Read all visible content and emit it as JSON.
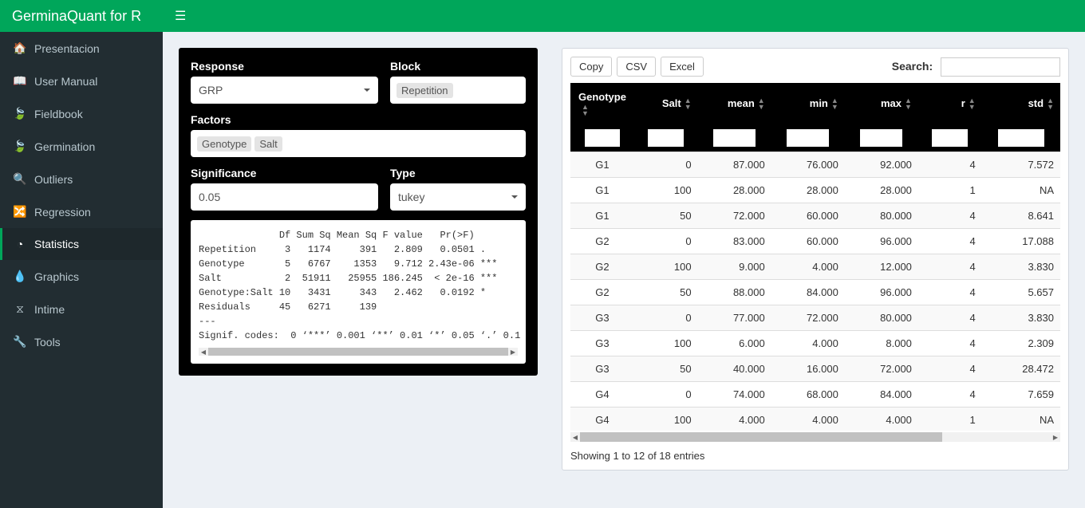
{
  "header": {
    "title": "GerminaQuant for R"
  },
  "sidebar": {
    "items": [
      {
        "icon": "🏠",
        "label": "Presentacion"
      },
      {
        "icon": "📖",
        "label": "User Manual"
      },
      {
        "icon": "🍃",
        "label": "Fieldbook"
      },
      {
        "icon": "🍃",
        "label": "Germination"
      },
      {
        "icon": "🔍",
        "label": "Outliers"
      },
      {
        "icon": "🔀",
        "label": "Regression"
      },
      {
        "icon": "◔",
        "label": "Statistics",
        "active": true
      },
      {
        "icon": "💧",
        "label": "Graphics"
      },
      {
        "icon": "⧖",
        "label": "Intime"
      },
      {
        "icon": "🔧",
        "label": "Tools"
      }
    ]
  },
  "form": {
    "response_label": "Response",
    "response_value": "GRP",
    "block_label": "Block",
    "block_token": "Repetition",
    "factors_label": "Factors",
    "factors_tokens": [
      "Genotype",
      "Salt"
    ],
    "significance_label": "Significance",
    "significance_value": "0.05",
    "type_label": "Type",
    "type_value": "tukey"
  },
  "anova_text": "              Df Sum Sq Mean Sq F value   Pr(>F)    \nRepetition     3   1174     391   2.809   0.0501 .  \nGenotype       5   6767    1353   9.712 2.43e-06 ***\nSalt           2  51911   25955 186.245  < 2e-16 ***\nGenotype:Salt 10   3431     343   2.462   0.0192 *  \nResiduals     45   6271     139                     \n---\nSignif. codes:  0 ‘***’ 0.001 ‘**’ 0.01 ‘*’ 0.05 ‘.’ 0.1 ",
  "dt": {
    "buttons": {
      "copy": "Copy",
      "csv": "CSV",
      "excel": "Excel"
    },
    "search_label": "Search:",
    "columns": [
      "Genotype",
      "Salt",
      "mean",
      "min",
      "max",
      "r",
      "std"
    ],
    "rows": [
      [
        "G1",
        "0",
        "87.000",
        "76.000",
        "92.000",
        "4",
        "7.572"
      ],
      [
        "G1",
        "100",
        "28.000",
        "28.000",
        "28.000",
        "1",
        "NA"
      ],
      [
        "G1",
        "50",
        "72.000",
        "60.000",
        "80.000",
        "4",
        "8.641"
      ],
      [
        "G2",
        "0",
        "83.000",
        "60.000",
        "96.000",
        "4",
        "17.088"
      ],
      [
        "G2",
        "100",
        "9.000",
        "4.000",
        "12.000",
        "4",
        "3.830"
      ],
      [
        "G2",
        "50",
        "88.000",
        "84.000",
        "96.000",
        "4",
        "5.657"
      ],
      [
        "G3",
        "0",
        "77.000",
        "72.000",
        "80.000",
        "4",
        "3.830"
      ],
      [
        "G3",
        "100",
        "6.000",
        "4.000",
        "8.000",
        "4",
        "2.309"
      ],
      [
        "G3",
        "50",
        "40.000",
        "16.000",
        "72.000",
        "4",
        "28.472"
      ],
      [
        "G4",
        "0",
        "74.000",
        "68.000",
        "84.000",
        "4",
        "7.659"
      ],
      [
        "G4",
        "100",
        "4.000",
        "4.000",
        "4.000",
        "1",
        "NA"
      ]
    ],
    "info": "Showing 1 to 12 of 18 entries"
  }
}
